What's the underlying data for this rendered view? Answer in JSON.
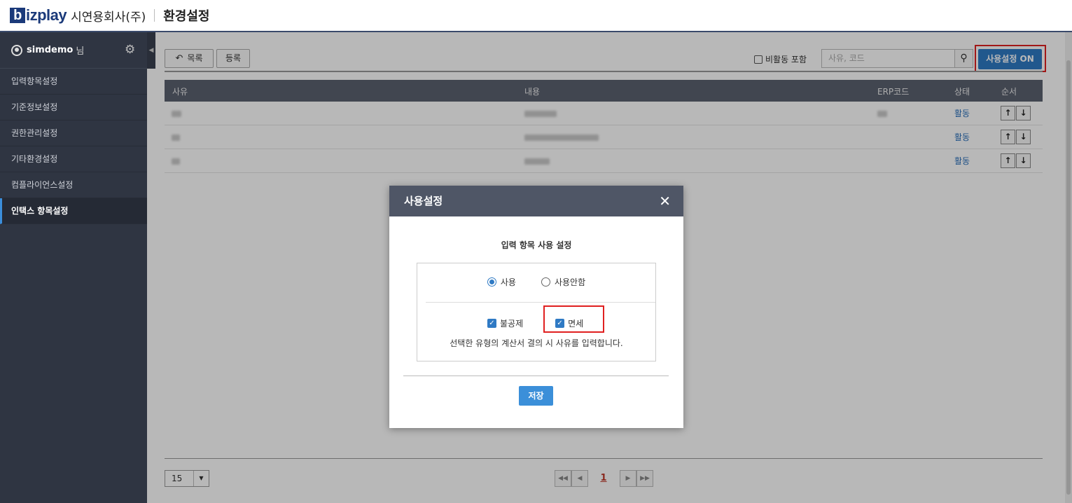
{
  "header": {
    "logo_b": "b",
    "logo_rest": "izplay",
    "company": "시연용회사(주)",
    "title": "환경설정"
  },
  "sidebar": {
    "user": "simdemo",
    "user_suffix": "님",
    "items": [
      {
        "label": "입력항목설정"
      },
      {
        "label": "기준정보설정"
      },
      {
        "label": "권한관리설정"
      },
      {
        "label": "기타환경설정"
      },
      {
        "label": "컴플라이언스설정"
      },
      {
        "label": "인택스 항목설정"
      }
    ],
    "active_index": 5
  },
  "toolbar": {
    "list_label": "목록",
    "register_label": "등록",
    "inactive_label": "비활동 포함",
    "search_placeholder": "사유, 코드",
    "usage_on_label": "사용설정 ON"
  },
  "table": {
    "headers": [
      "사유",
      "내용",
      "ERP코드",
      "상태",
      "순서"
    ],
    "rows": [
      {
        "status": "활동"
      },
      {
        "status": "활동"
      },
      {
        "status": "활동"
      }
    ]
  },
  "pagination": {
    "page_size": "15",
    "current_page": "1"
  },
  "modal": {
    "title": "사용설정",
    "subtitle": "입력 항목 사용 설정",
    "radio_use": "사용",
    "radio_nouse": "사용안함",
    "check1": "불공제",
    "check2": "면세",
    "description": "선택한 유형의 계산서 결의 시 사유를 입력합니다.",
    "save_label": "저장"
  },
  "colors": {
    "accent": "#2f7ac4",
    "highlight": "#e02020",
    "sidebar_bg": "#2f3542"
  }
}
